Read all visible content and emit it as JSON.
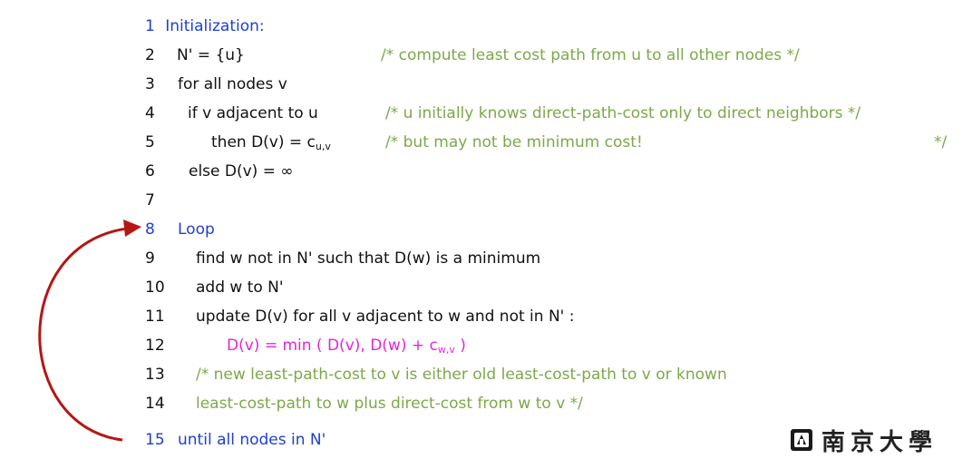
{
  "lines": [
    {
      "num": "1",
      "text": "Initialization:",
      "comment": ""
    },
    {
      "num": "2",
      "text": "N' = {u}",
      "comment": "/* compute least cost path from u to all other nodes */"
    },
    {
      "num": "3",
      "text": "for all nodes v",
      "comment": ""
    },
    {
      "num": "4",
      "text": "if v adjacent to u",
      "comment": "/* u initially knows direct-path-cost only to  direct neighbors   */"
    },
    {
      "num": "5",
      "text_prefix": "then D(v) = c",
      "text_sub": "u,v",
      "comment": "/* but may not be minimum cost!",
      "comment_end": "*/"
    },
    {
      "num": "6",
      "text": "else D(v) = ∞",
      "comment": ""
    },
    {
      "num": "7",
      "text": "",
      "comment": ""
    },
    {
      "num": "8",
      "text": "Loop",
      "comment": ""
    },
    {
      "num": "9",
      "text": "find w not in N' such that D(w) is a minimum",
      "comment": ""
    },
    {
      "num": "10",
      "text": "add w to N'",
      "comment": ""
    },
    {
      "num": "11",
      "text": "update D(v) for all v adjacent to w and not in N' :",
      "comment": ""
    },
    {
      "num": "12",
      "text_prefix": "D(v) = min ( D(v),  D(w) + c",
      "text_sub": "w,v",
      "text_suffix": " )",
      "comment": ""
    },
    {
      "num": "13",
      "text": "/* new least-path-cost to v is either old least-cost-path to v or known",
      "comment": ""
    },
    {
      "num": "14",
      "text": "least-cost-path to w plus direct-cost from w to v */",
      "comment": ""
    },
    {
      "num": "15",
      "text": "until all nodes in N'",
      "comment": ""
    }
  ],
  "logo": {
    "text": "南京大學",
    "icon": "university-seal-icon"
  },
  "colors": {
    "blue": "#1d3fd6",
    "green": "#7ca84a",
    "pink": "#e326d8",
    "arrow": "#b51616"
  }
}
